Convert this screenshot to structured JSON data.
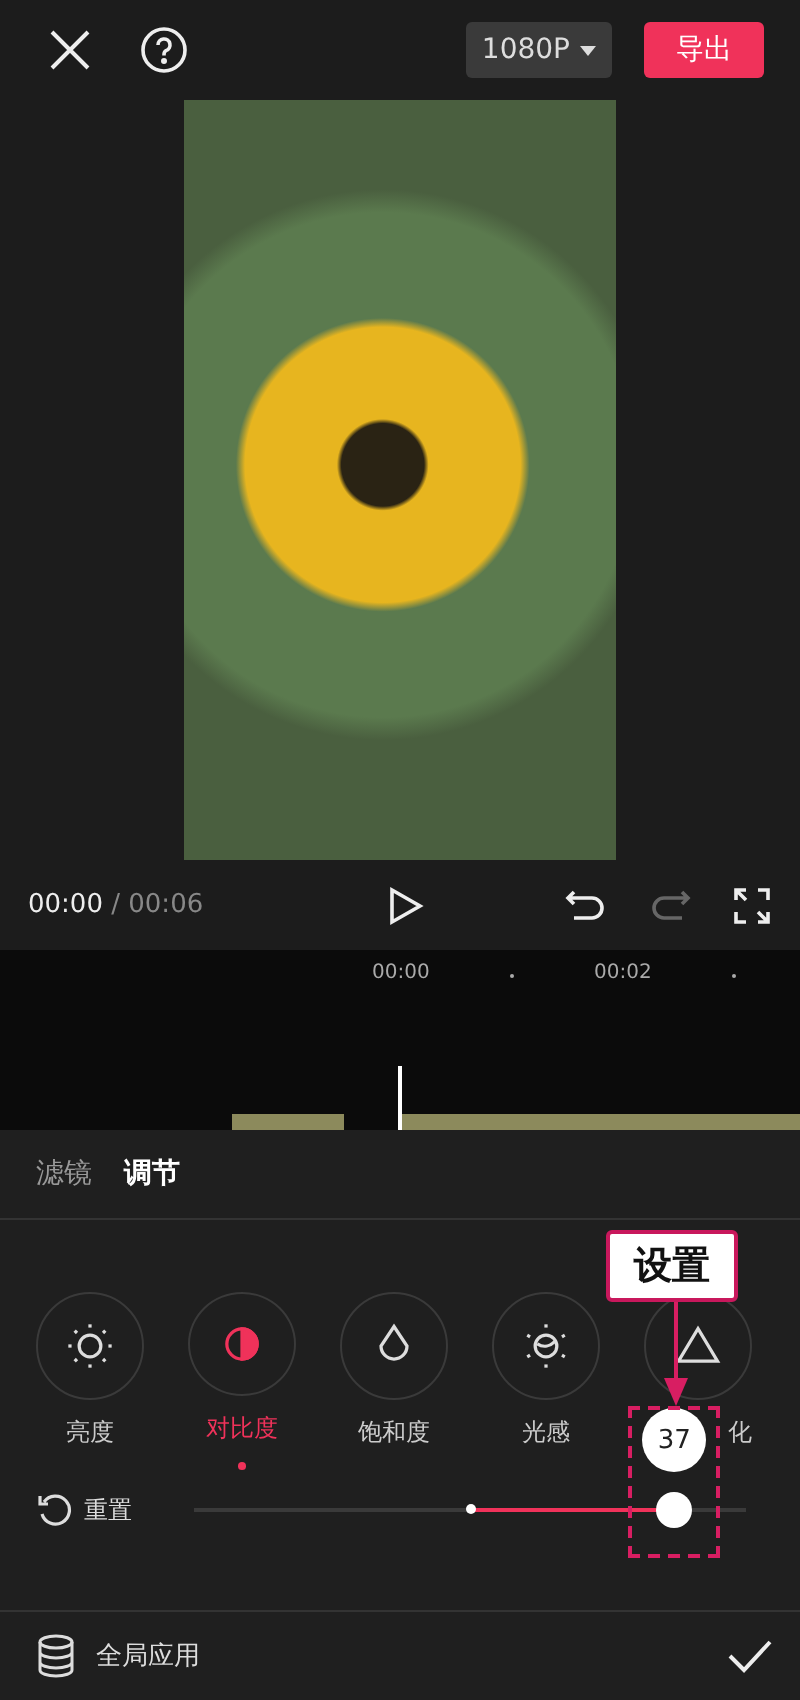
{
  "top_bar": {
    "resolution": "1080P",
    "export_button": "导出"
  },
  "player": {
    "current_time": "00:00",
    "separator": "/",
    "total_time": "00:06",
    "redo_disabled": true
  },
  "timeline": {
    "ticks": [
      "00:00",
      "00:02"
    ]
  },
  "tabs": [
    {
      "label": "滤镜",
      "selected": false
    },
    {
      "label": "调节",
      "selected": true
    }
  ],
  "adjustments": [
    {
      "kind": "brightness",
      "label": "亮度",
      "selected": false
    },
    {
      "kind": "contrast",
      "label": "对比度",
      "selected": true
    },
    {
      "kind": "saturation",
      "label": "饱和度",
      "selected": false
    },
    {
      "kind": "exposure",
      "label": "光感",
      "selected": false
    },
    {
      "kind": "sharpen",
      "label": "化",
      "selected": false
    }
  ],
  "slider": {
    "reset_label": "重置",
    "value": "37",
    "level": 0.87
  },
  "annotation": {
    "label": "设置"
  },
  "bottom_bar": {
    "apply_all": "全局应用"
  }
}
